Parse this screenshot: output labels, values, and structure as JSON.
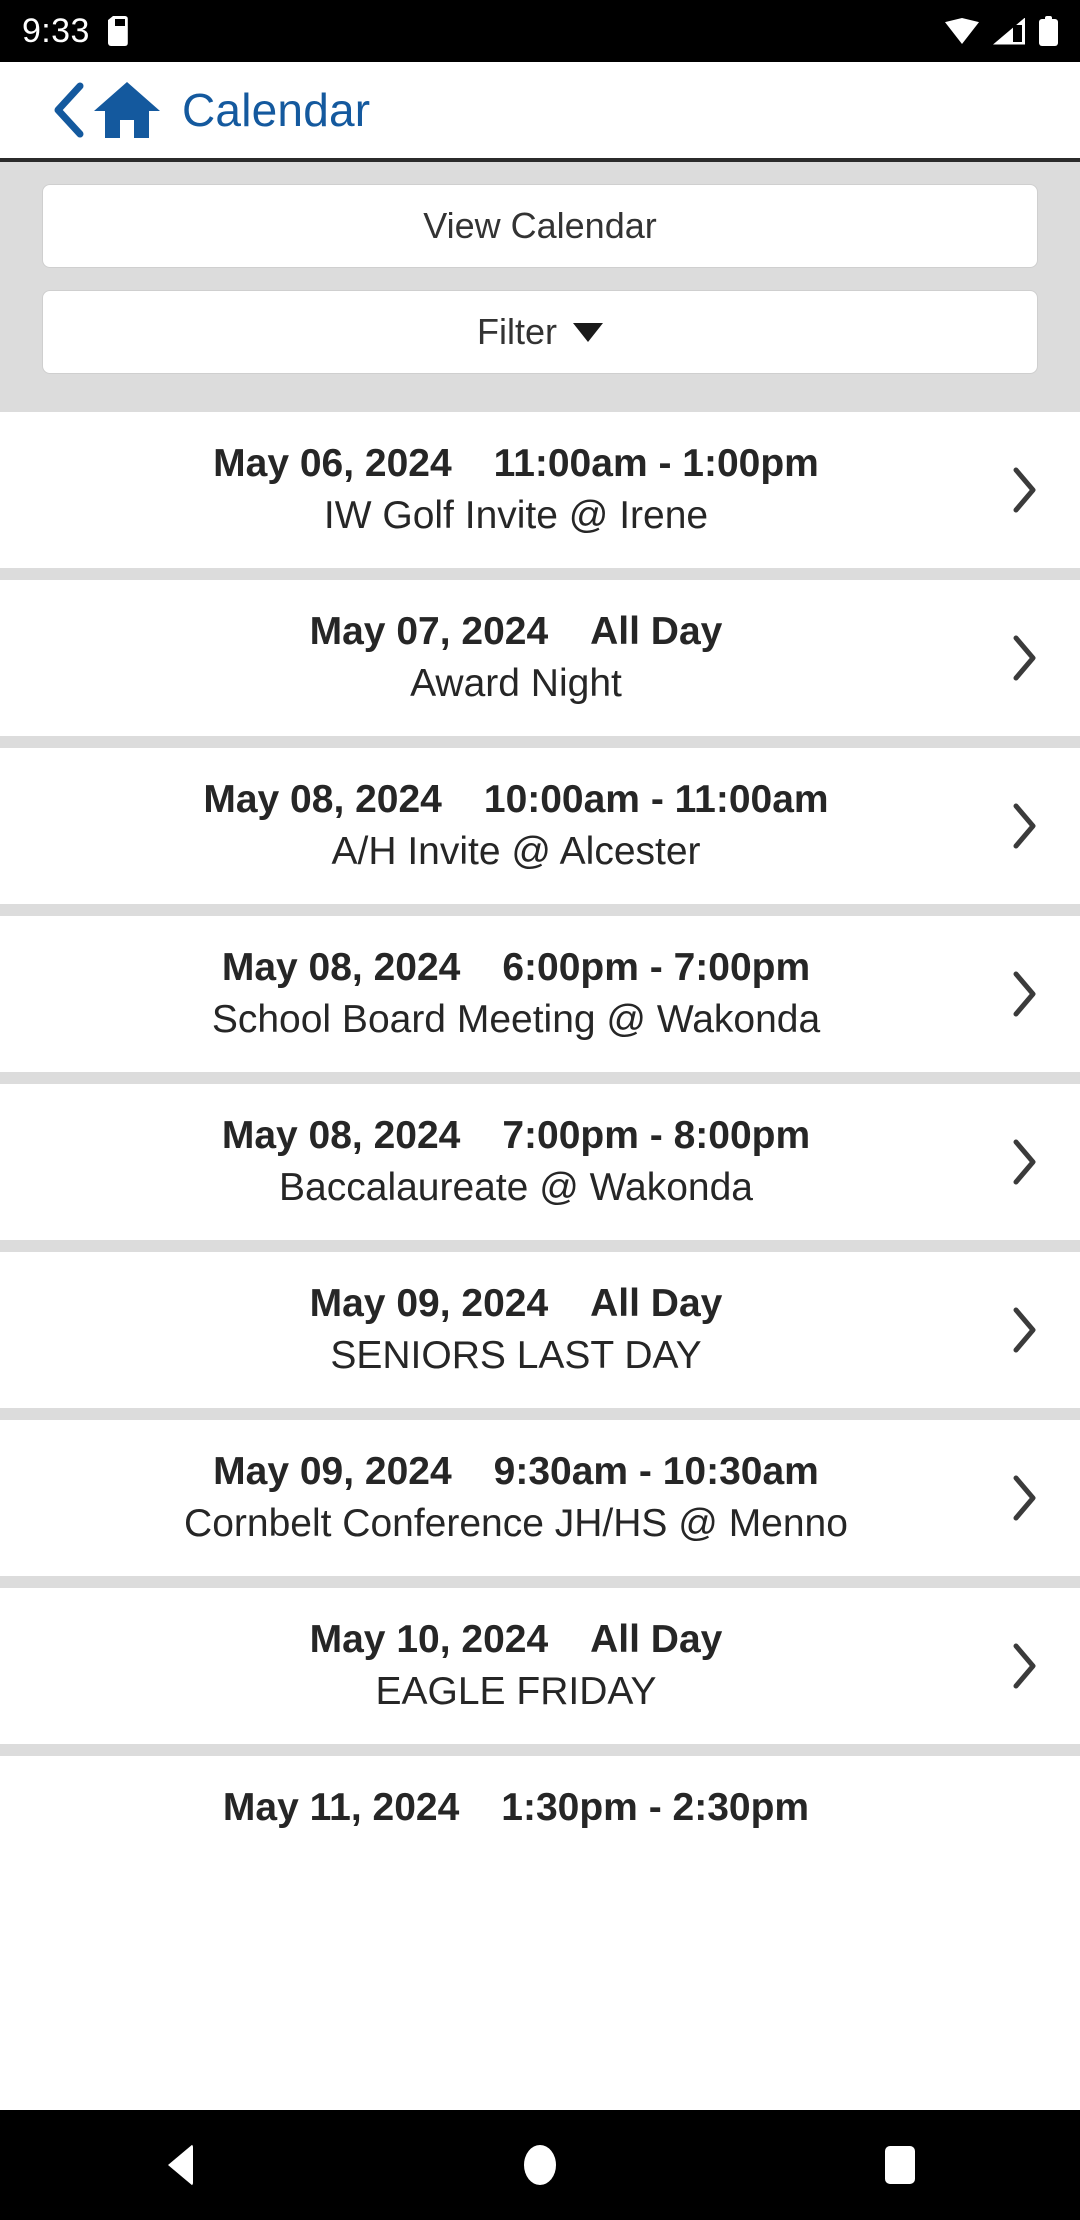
{
  "statusbar": {
    "time": "9:33",
    "icons": [
      "sd-card-icon",
      "wifi-icon",
      "cellular-signal-icon",
      "battery-icon"
    ]
  },
  "appbar": {
    "back_icon": "back-chevron-icon",
    "home_icon": "home-icon",
    "title": "Calendar",
    "accent_color": "#14599e"
  },
  "toolbar": {
    "view_calendar_label": "View Calendar",
    "filter_label": "Filter",
    "filter_caret_icon": "caret-down-icon"
  },
  "events": [
    {
      "date": "May 06, 2024",
      "time": "11:00am - 1:00pm",
      "title": "IW Golf Invite @ Irene"
    },
    {
      "date": "May 07, 2024",
      "time": "All Day",
      "title": "Award Night"
    },
    {
      "date": "May 08, 2024",
      "time": "10:00am - 11:00am",
      "title": "A/H Invite @ Alcester"
    },
    {
      "date": "May 08, 2024",
      "time": "6:00pm - 7:00pm",
      "title": "School Board Meeting @ Wakonda"
    },
    {
      "date": "May 08, 2024",
      "time": "7:00pm - 8:00pm",
      "title": "Baccalaureate @ Wakonda"
    },
    {
      "date": "May 09, 2024",
      "time": "All Day",
      "title": "SENIORS LAST DAY"
    },
    {
      "date": "May 09, 2024",
      "time": "9:30am - 10:30am",
      "title": "Cornbelt Conference JH/HS @ Menno"
    },
    {
      "date": "May 10, 2024",
      "time": "All Day",
      "title": "EAGLE FRIDAY"
    },
    {
      "date": "May 11, 2024",
      "time": "1:30pm - 2:30pm",
      "title": ""
    }
  ],
  "navbar": {
    "back_label": "back-triangle-icon",
    "home_label": "home-circle-icon",
    "recent_label": "recent-square-icon"
  }
}
